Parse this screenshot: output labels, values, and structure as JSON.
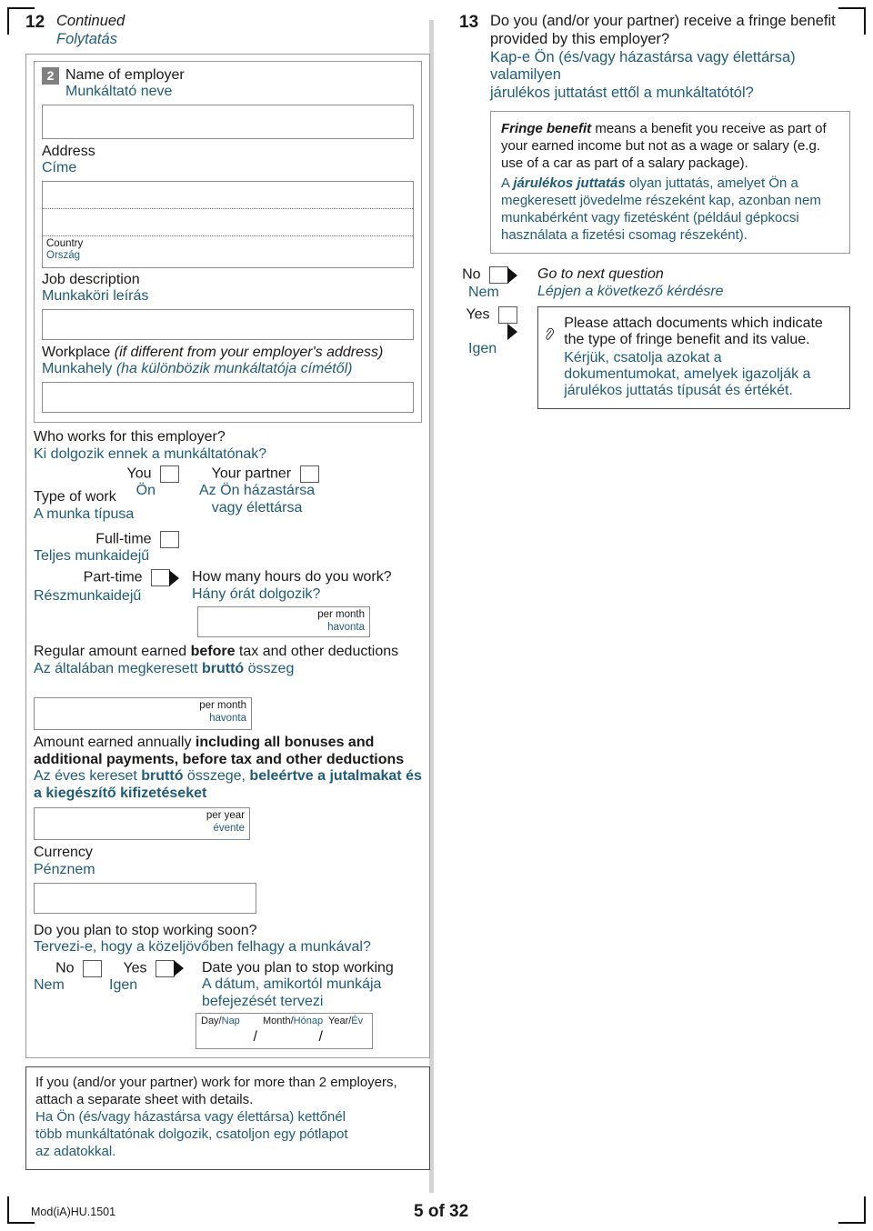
{
  "meta": {
    "form_code": "Mod(iA)HU.1501",
    "page_label": "5 of 32",
    "accent_blue": "#1f5c7a",
    "badge_gray": "#808080"
  },
  "q12": {
    "number": "12",
    "title_en": "Continued",
    "title_hu": "Folytatás",
    "employer": {
      "badge": "2",
      "name_en": "Name of employer",
      "name_hu": "Munkáltató neve",
      "address_en": "Address",
      "address_hu": "Címe",
      "country_en": "Country",
      "country_hu": "Ország",
      "job_en": "Job description",
      "job_hu": "Munkaköri leírás",
      "workplace_en_main": "Workplace ",
      "workplace_en_ital": "(if different from your employer's address)",
      "workplace_hu_main": "Munkahely ",
      "workplace_hu_ital": "(ha különbözik munkáltatója címétől)"
    },
    "who_works": {
      "question_en": "Who works for this employer?",
      "question_hu": "Ki dolgozik ennek a munkáltatónak?",
      "you_en": "You",
      "you_hu": "Ön",
      "partner_en": "Your partner",
      "partner_hu_line1": "Az Ön házastársa",
      "partner_hu_line2": "vagy élettársa"
    },
    "type_of_work": {
      "label_en": "Type of work",
      "label_hu": "A munka típusa",
      "fulltime_en": "Full-time",
      "fulltime_hu": "Teljes munkaidejű",
      "parttime_en": "Part-time",
      "parttime_hu": "Részmunkaidejű",
      "hours_en": "How many hours do you work?",
      "hours_hu": "Hány órát dolgozik?",
      "hours_unit_en": "per month",
      "hours_unit_hu": "havonta"
    },
    "regular_amount": {
      "text_en_a": "Regular amount earned ",
      "text_en_b": "before",
      "text_en_c": " tax and other deductions",
      "text_hu_a": "Az általában megkeresett ",
      "text_hu_b": "bruttó",
      "text_hu_c": " összeg",
      "unit_en": "per month",
      "unit_hu": "havonta"
    },
    "annual_amount": {
      "text_en_a": "Amount earned annually ",
      "text_en_b": "including all bonuses and additional payments, before tax and other deductions",
      "text_hu_a": "Az éves kereset ",
      "text_hu_b": "bruttó",
      "text_hu_c": " összege, ",
      "text_hu_d": "beleértve a jutalmakat és a kiegészítő kifizetéseket",
      "unit_en": "per year",
      "unit_hu": "évente"
    },
    "currency": {
      "label_en": "Currency",
      "label_hu": "Pénznem"
    },
    "stop_working": {
      "question_en": "Do you plan to stop working soon?",
      "question_hu": "Tervezi-e, hogy a közeljövőben felhagy a munkával?",
      "no_en": "No",
      "no_hu": "Nem",
      "yes_en": "Yes",
      "yes_hu": "Igen",
      "date_en": "Date you plan to stop working",
      "date_hu_line1": "A dátum, amikortól munkája",
      "date_hu_line2": "befejezését tervezi",
      "day": "Day/",
      "day_hu": "Nap",
      "month": "Month/",
      "month_hu": "Hónap",
      "year": "Year/",
      "year_hu": "Év",
      "sep": "/"
    },
    "note": {
      "en_line1": "If you (and/or your partner) work for more than 2 employers,",
      "en_line2": "attach a separate sheet with details.",
      "hu_line1": "Ha Ön (és/vagy házastársa vagy élettársa) kettőnél",
      "hu_line2": "több munkáltatónak dolgozik, csatoljon egy pótlapot",
      "hu_line3": "az adatokkal."
    }
  },
  "q13": {
    "number": "13",
    "question_en_line1": "Do you (and/or your partner) receive a fringe benefit",
    "question_en_line2": "provided by this employer?",
    "question_hu_line1": "Kap-e Ön (és/vagy házastársa vagy élettársa) valamilyen",
    "question_hu_line2": "járulékos juttatást ettől a munkáltatótól?",
    "definition": {
      "en_bold": "Fringe benefit",
      "en_rest": " means a benefit you receive as part of your earned income but not as a wage or salary (e.g. use of a car as part of a salary package).",
      "hu_pre": "A ",
      "hu_bold": "járulékos juttatás",
      "hu_rest": " olyan juttatás, amelyet Ön a megkeresett jövedelme részeként kap, azonban nem munkabérként vagy fizetésként (például gépkocsi használata a fizetési csomag részeként)."
    },
    "no_en": "No",
    "no_hu": "Nem",
    "goto_en": "Go to next question",
    "goto_hu": "Lépjen a következő kérdésre",
    "yes_en": "Yes",
    "yes_hu": "Igen",
    "attach": {
      "icon": "paperclip-icon",
      "en": "Please attach documents which indicate the type of fringe benefit and its value.",
      "hu": "Kérjük, csatolja azokat a dokumentumokat, amelyek igazolják a járulékos juttatás típusát és értékét."
    }
  }
}
